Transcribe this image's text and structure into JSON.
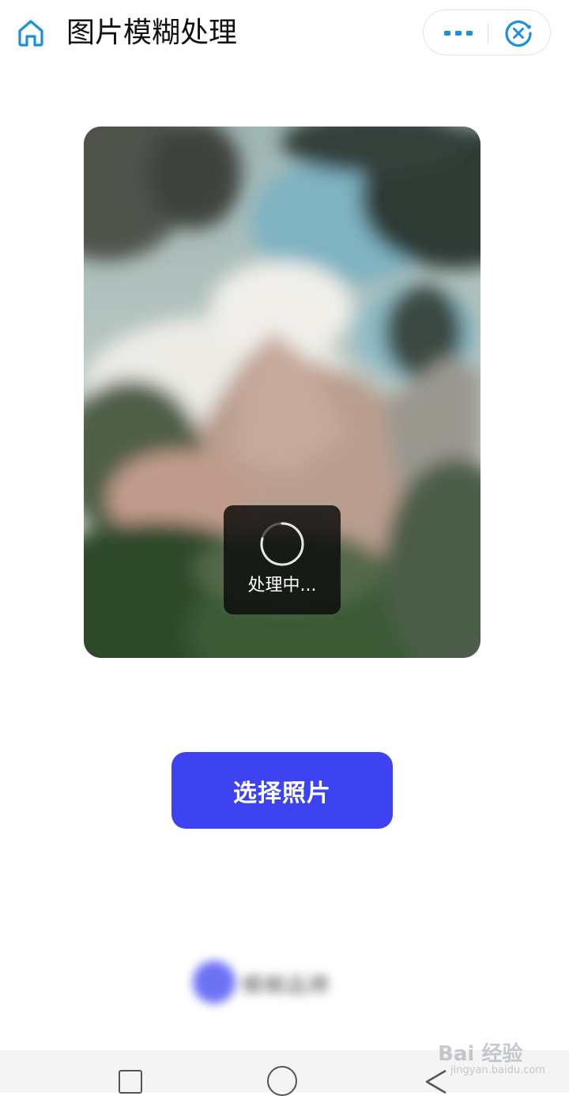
{
  "header": {
    "title": "图片模糊处理",
    "home_icon": "home-icon",
    "more_icon": "more-dots-icon",
    "close_icon": "close-target-icon",
    "accent_color": "#1a8fe0"
  },
  "preview": {
    "image_description_icon": "blurred-mountain-photo",
    "loading_label": "处理中..."
  },
  "actions": {
    "select_photo_label": "选择照片",
    "button_color": "#3d43f0"
  },
  "footer": {
    "brand_text": "模糊品牌"
  },
  "system_nav": {
    "square_icon": "recent-apps-icon",
    "circle_icon": "home-circle-icon",
    "back_icon": "back-triangle-icon"
  },
  "watermark": {
    "main": "Bai 经验",
    "sub": "jingyan.baidu.com"
  }
}
